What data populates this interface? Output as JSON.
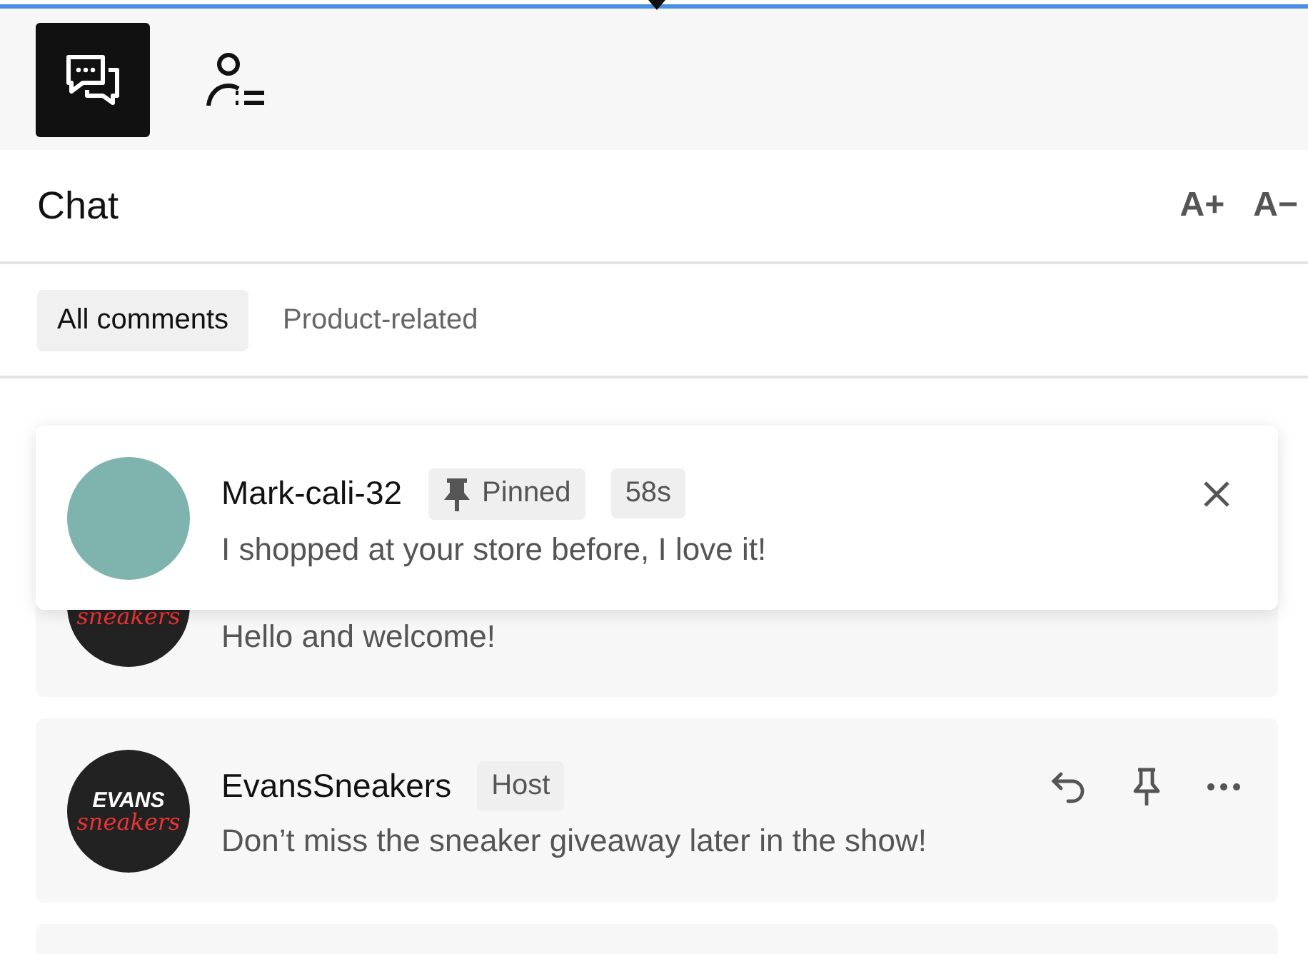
{
  "toolbar": {
    "tabs": [
      {
        "kind": "chat",
        "selected": true
      },
      {
        "kind": "viewers",
        "selected": false
      }
    ]
  },
  "header": {
    "title": "Chat",
    "font_buttons": [
      "A+",
      "A−"
    ]
  },
  "filters": [
    {
      "label": "All comments",
      "selected": true
    },
    {
      "label": "Product-related",
      "selected": false
    }
  ],
  "pinned": {
    "name": "Mark-cali-32",
    "badge": "Pinned",
    "time": "58s",
    "message": "I shopped at your store before, I love it!"
  },
  "comments": [
    {
      "message": "Hello and welcome!",
      "avatar_text": [
        "sneakers"
      ]
    },
    {
      "name": "EvansSneakers",
      "badge": "Host",
      "message": "Don’t miss the sneaker giveaway later in the show!",
      "avatar_text": [
        "EVANS",
        "sneakers"
      ],
      "actions": true
    }
  ]
}
